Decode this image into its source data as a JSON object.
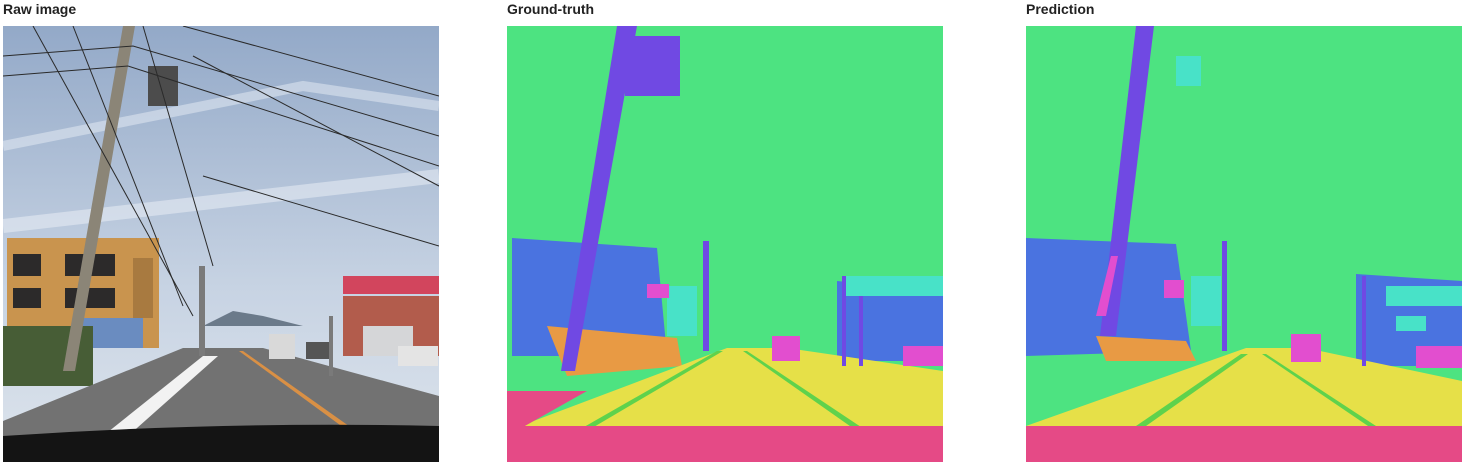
{
  "panels": [
    {
      "title": "Raw image"
    },
    {
      "title": "Ground-truth"
    },
    {
      "title": "Prediction"
    }
  ],
  "colors": {
    "sky": "#4de381",
    "road": "#e6e048",
    "ego_vehicle": "#e54a86",
    "pole": "#7049e3",
    "building": "#4a73e0",
    "sign": "#48e2c8",
    "vegetation_ground": "#e89a44",
    "vehicle": "#e24ecf",
    "lane_marking": "#5fd24c"
  }
}
